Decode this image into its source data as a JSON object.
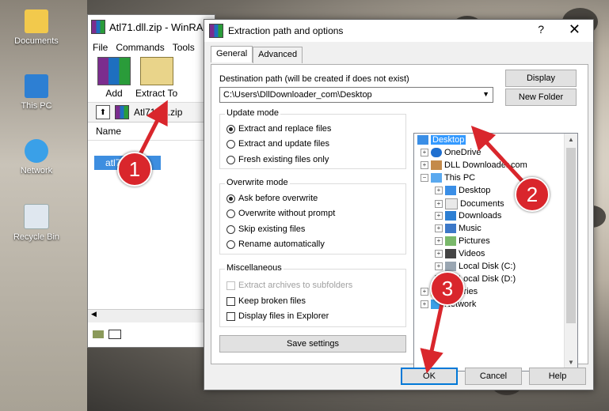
{
  "desktop": {
    "icons": [
      {
        "label": "Documents"
      },
      {
        "label": "This PC"
      },
      {
        "label": "Network"
      },
      {
        "label": "Recycle Bin"
      }
    ]
  },
  "winrar": {
    "title": "Atl71.dll.zip - WinRAR",
    "menu": [
      "File",
      "Commands",
      "Tools"
    ],
    "toolbar": [
      {
        "label": "Add"
      },
      {
        "label": "Extract To"
      }
    ],
    "path": "Atl71.dll.zip",
    "column_name": "Name",
    "selected_row": "atl71.dll"
  },
  "dialog": {
    "title": "Extraction path and options",
    "help": "?",
    "close": "✕",
    "tabs": [
      "General",
      "Advanced"
    ],
    "dest_label": "Destination path (will be created if does not exist)",
    "dest_value": "C:\\Users\\DllDownloader_com\\Desktop",
    "display_btn": "Display",
    "newfolder_btn": "New Folder",
    "update_mode": {
      "title": "Update mode",
      "options": [
        "Extract and replace files",
        "Extract and update files",
        "Fresh existing files only"
      ],
      "selected": 0
    },
    "overwrite_mode": {
      "title": "Overwrite mode",
      "options": [
        "Ask before overwrite",
        "Overwrite without prompt",
        "Skip existing files",
        "Rename automatically"
      ],
      "selected": 0
    },
    "misc": {
      "title": "Miscellaneous",
      "options": [
        "Extract archives to subfolders",
        "Keep broken files",
        "Display files in Explorer"
      ]
    },
    "save_settings": "Save settings",
    "tree": [
      {
        "label": "Desktop",
        "selected": true
      },
      {
        "label": "OneDrive"
      },
      {
        "label": "DLL Downloader.com"
      },
      {
        "label": "This PC"
      },
      {
        "label": "Desktop"
      },
      {
        "label": "Documents"
      },
      {
        "label": "Downloads"
      },
      {
        "label": "Music"
      },
      {
        "label": "Pictures"
      },
      {
        "label": "Videos"
      },
      {
        "label": "Local Disk (C:)"
      },
      {
        "label": "Local Disk (D:)"
      },
      {
        "label": "Libraries"
      },
      {
        "label": "Network"
      }
    ],
    "ok": "OK",
    "cancel": "Cancel",
    "help_btn": "Help"
  },
  "annotations": [
    "1",
    "2",
    "3"
  ],
  "colors": {
    "accent": "#0078d7",
    "marker": "#d9262c",
    "selection": "#3399ff"
  }
}
